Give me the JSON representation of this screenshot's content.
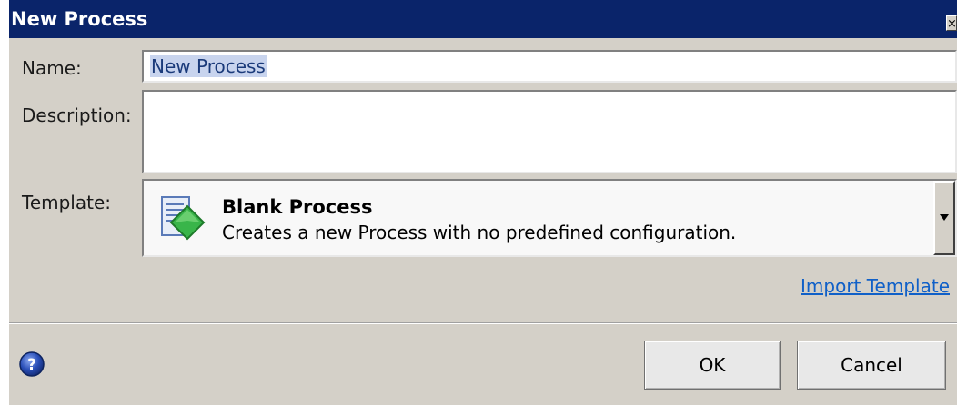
{
  "dialog": {
    "title": "New Process",
    "close_glyph": "×"
  },
  "form": {
    "name_label": "Name:",
    "name_value": "New Process",
    "description_label": "Description:",
    "description_value": "",
    "template_label": "Template:"
  },
  "template": {
    "selected_title": "Blank Process",
    "selected_description": "Creates a new Process with no predefined configuration.",
    "icon": "blank-process-icon"
  },
  "links": {
    "import_template": "Import Template"
  },
  "buttons": {
    "ok": "OK",
    "cancel": "Cancel",
    "help_icon": "help-icon"
  },
  "colors": {
    "titlebar": "#0a246a",
    "dialog_bg": "#d4d0c8",
    "link": "#1060c8",
    "selection": "#c8d4ee"
  }
}
